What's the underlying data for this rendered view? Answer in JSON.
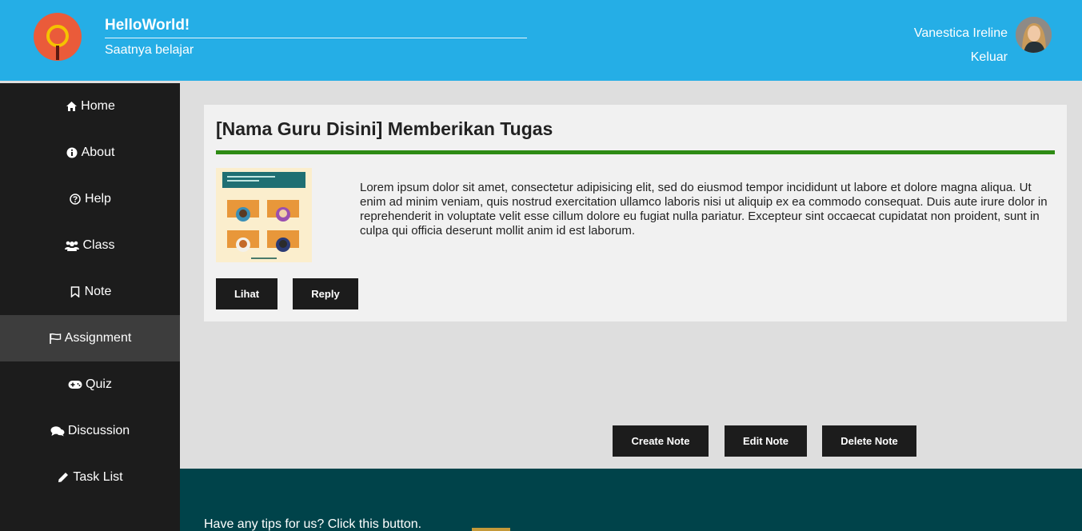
{
  "header": {
    "brand_title": "HelloWorld!",
    "brand_subtitle": "Saatnya belajar",
    "user_name": "Vanestica Ireline",
    "logout_label": "Keluar"
  },
  "sidebar": {
    "items": [
      {
        "label": "Home",
        "icon": "home-icon"
      },
      {
        "label": "About",
        "icon": "info-icon"
      },
      {
        "label": "Help",
        "icon": "help-icon"
      },
      {
        "label": "Class",
        "icon": "users-icon"
      },
      {
        "label": "Note",
        "icon": "bookmark-icon"
      },
      {
        "label": "Assignment",
        "icon": "flag-icon",
        "active": true
      },
      {
        "label": "Quiz",
        "icon": "gamepad-icon"
      },
      {
        "label": "Discussion",
        "icon": "comments-icon"
      },
      {
        "label": "Task List",
        "icon": "pencil-icon"
      }
    ]
  },
  "assignment": {
    "title": "[Nama Guru Disini] Memberikan Tugas",
    "body": "Lorem ipsum dolor sit amet, consectetur adipisicing elit, sed do eiusmod tempor incididunt ut labore et dolore magna aliqua. Ut enim ad minim veniam, quis nostrud exercitation ullamco laboris nisi ut aliquip ex ea commodo consequat. Duis aute irure dolor in reprehenderit in voluptate velit esse cillum dolore eu fugiat nulla pariatur. Excepteur sint occaecat cupidatat non proident, sunt in culpa qui officia deserunt mollit anim id est laborum.",
    "view_label": "Lihat",
    "reply_label": "Reply"
  },
  "note_actions": {
    "create_label": "Create Note",
    "edit_label": "Edit Note",
    "delete_label": "Delete Note"
  },
  "footer": {
    "tip_text": "Have any tips for us? Click this button."
  },
  "colors": {
    "header_bg": "#25aee6",
    "sidebar_bg": "#1c1c1c",
    "sidebar_active": "#3d3d3d",
    "accent_rule": "#2e8b14",
    "footer_bg": "#00434a"
  }
}
